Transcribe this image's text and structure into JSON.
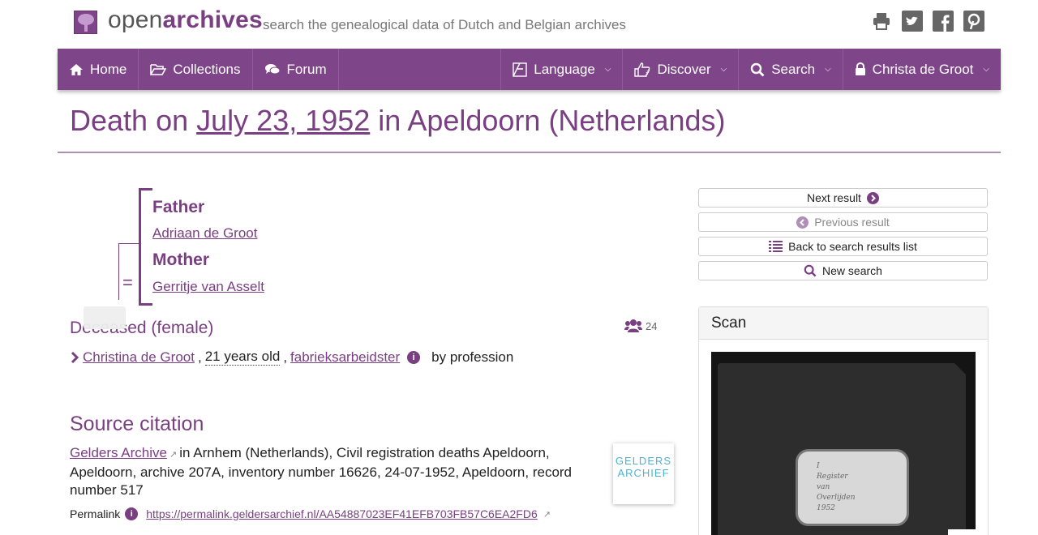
{
  "header": {
    "brand_prefix": "open",
    "brand_suffix": "archives",
    "tagline": "search the genealogical data of Dutch and Belgian archives",
    "social_icons": [
      "print-icon",
      "twitter-icon",
      "facebook-icon",
      "pinterest-icon"
    ]
  },
  "nav": {
    "home": "Home",
    "collections": "Collections",
    "forum": "Forum",
    "language": "Language",
    "discover": "Discover",
    "search": "Search",
    "user": "Christa de Groot"
  },
  "title": {
    "prefix": "Death on ",
    "date": "July 23, 1952",
    "suffix": " in Apeldoorn (Netherlands)"
  },
  "parents": {
    "father_label": "Father",
    "father_name": "Adriaan de Groot",
    "mother_label": "Mother",
    "mother_name": "Gerritje van Asselt",
    "equals": "="
  },
  "deceased": {
    "heading": "Deceased (female)",
    "group_count": "24",
    "name": "Christina de Groot",
    "sep1": ", ",
    "age": "21 years old",
    "sep2": ", ",
    "profession": "fabrieksarbeidster",
    "by_profession": "by profession"
  },
  "source": {
    "heading": "Source citation",
    "archive_link": "Gelders Archive",
    "text": "in Arnhem (Netherlands), Civil registration deaths Apeldoorn, Apeldoorn, archive 207A, inventory number 16626, 24-07-1952, Apeldoorn, record number 517",
    "permalink_label": "Permalink",
    "permalink_url": "https://permalink.geldersarchief.nl/AA54887023EF41EFB703FB57C6EA2FD6",
    "logo_line1": "GELDERS",
    "logo_line2": "ARCHIEF"
  },
  "sidebar": {
    "next": "Next result",
    "previous": "Previous result",
    "back": "Back to search results list",
    "new_search": "New search",
    "scan_title": "Scan",
    "scan_text_l1": "I",
    "scan_text_l2": "Register",
    "scan_text_l3": "van",
    "scan_text_l4": "Overlijden",
    "scan_text_l5": "1952"
  },
  "colors": {
    "accent": "#7a3f82",
    "nav_bg": "#7f4589"
  }
}
